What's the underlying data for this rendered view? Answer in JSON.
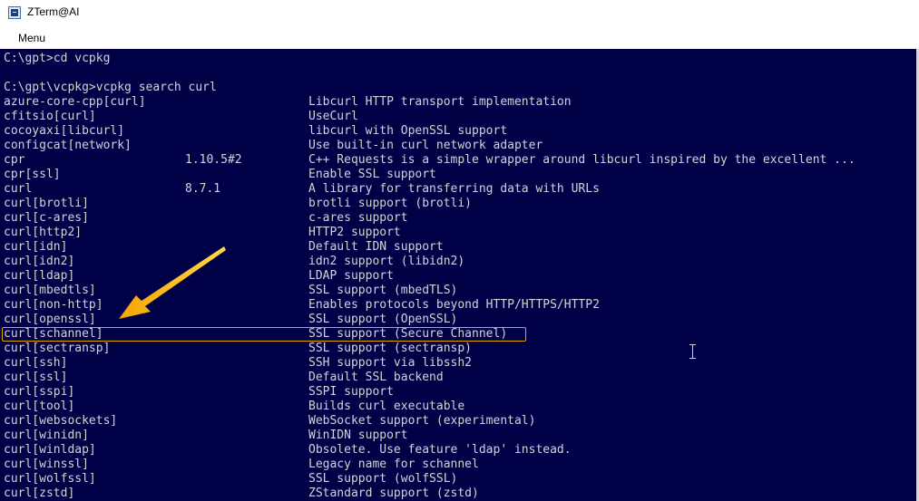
{
  "window": {
    "title": "ZTerm@AI"
  },
  "menu": {
    "items": [
      "Menu"
    ]
  },
  "terminal": {
    "lines": [
      {
        "name": "C:\\gpt>cd vcpkg",
        "version": "",
        "description": ""
      },
      {
        "name": "",
        "version": "",
        "description": ""
      },
      {
        "name": "C:\\gpt\\vcpkg>vcpkg search curl",
        "version": "",
        "description": ""
      },
      {
        "name": "azure-core-cpp[curl]",
        "version": "",
        "description": "Libcurl HTTP transport implementation"
      },
      {
        "name": "cfitsio[curl]",
        "version": "",
        "description": "UseCurl"
      },
      {
        "name": "cocoyaxi[libcurl]",
        "version": "",
        "description": "libcurl with OpenSSL support"
      },
      {
        "name": "configcat[network]",
        "version": "",
        "description": "Use built-in curl network adapter"
      },
      {
        "name": "cpr",
        "version": "1.10.5#2",
        "description": "C++ Requests is a simple wrapper around libcurl inspired by the excellent ..."
      },
      {
        "name": "cpr[ssl]",
        "version": "",
        "description": "Enable SSL support"
      },
      {
        "name": "curl",
        "version": "8.7.1",
        "description": "A library for transferring data with URLs"
      },
      {
        "name": "curl[brotli]",
        "version": "",
        "description": "brotli support (brotli)"
      },
      {
        "name": "curl[c-ares]",
        "version": "",
        "description": "c-ares support"
      },
      {
        "name": "curl[http2]",
        "version": "",
        "description": "HTTP2 support"
      },
      {
        "name": "curl[idn]",
        "version": "",
        "description": "Default IDN support"
      },
      {
        "name": "curl[idn2]",
        "version": "",
        "description": "idn2 support (libidn2)"
      },
      {
        "name": "curl[ldap]",
        "version": "",
        "description": "LDAP support"
      },
      {
        "name": "curl[mbedtls]",
        "version": "",
        "description": "SSL support (mbedTLS)"
      },
      {
        "name": "curl[non-http]",
        "version": "",
        "description": "Enables protocols beyond HTTP/HTTPS/HTTP2"
      },
      {
        "name": "curl[openssl]",
        "version": "",
        "description": "SSL support (OpenSSL)"
      },
      {
        "name": "curl[schannel]",
        "version": "",
        "description": "SSL support (Secure Channel)",
        "highlighted": true
      },
      {
        "name": "curl[sectransp]",
        "version": "",
        "description": "SSL support (sectransp)"
      },
      {
        "name": "curl[ssh]",
        "version": "",
        "description": "SSH support via libssh2"
      },
      {
        "name": "curl[ssl]",
        "version": "",
        "description": "Default SSL backend"
      },
      {
        "name": "curl[sspi]",
        "version": "",
        "description": "SSPI support"
      },
      {
        "name": "curl[tool]",
        "version": "",
        "description": "Builds curl executable"
      },
      {
        "name": "curl[websockets]",
        "version": "",
        "description": "WebSocket support (experimental)"
      },
      {
        "name": "curl[winidn]",
        "version": "",
        "description": "WinIDN support"
      },
      {
        "name": "curl[winldap]",
        "version": "",
        "description": "Obsolete. Use feature 'ldap' instead."
      },
      {
        "name": "curl[winssl]",
        "version": "",
        "description": "Legacy name for schannel"
      },
      {
        "name": "curl[wolfssl]",
        "version": "",
        "description": "SSL support (wolfSSL)"
      },
      {
        "name": "curl[zstd]",
        "version": "",
        "description": "ZStandard support (zstd)"
      }
    ]
  },
  "colors": {
    "terminal_bg": "#000046",
    "terminal_fg": "#d4d4d4",
    "annotation": "#f2b300"
  },
  "icons": {
    "app": "terminal-app-icon",
    "cursor": "text-cursor-icon",
    "annotation": "arrow-icon"
  }
}
